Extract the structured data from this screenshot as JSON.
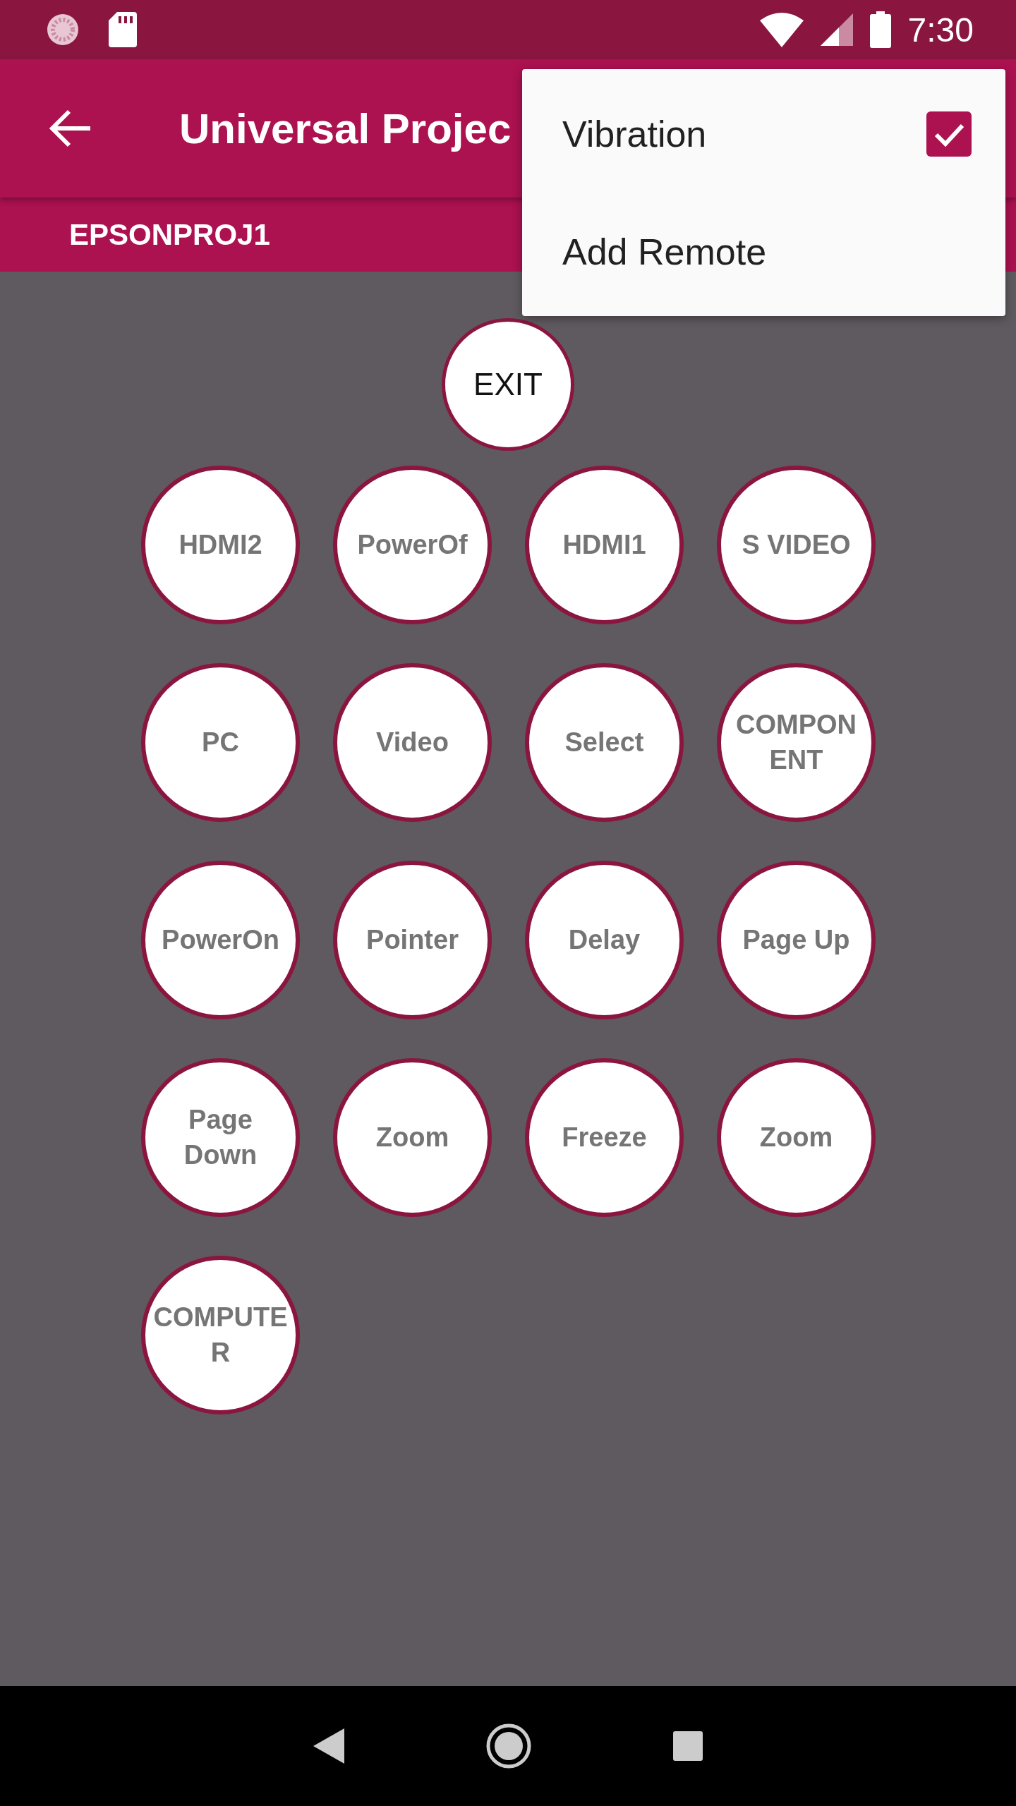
{
  "status_bar": {
    "time": "7:30"
  },
  "app_bar": {
    "title": "Universal Projec"
  },
  "device_tab": {
    "label": "EPSONPROJ1"
  },
  "overflow_menu": [
    {
      "label": "Vibration",
      "kind": "checkbox",
      "checked": true
    },
    {
      "label": "Add Remote",
      "kind": "action"
    }
  ],
  "exit_button": {
    "label": "EXIT"
  },
  "remote_buttons": [
    "HDMI2",
    "PowerOf",
    "HDMI1",
    "S VIDEO",
    "PC",
    "Video",
    "Select",
    "COMPONENT",
    "PowerOn",
    "Pointer",
    "Delay",
    "Page Up",
    "Page Down",
    "Zoom",
    "Freeze",
    "Zoom",
    "COMPUTER"
  ]
}
